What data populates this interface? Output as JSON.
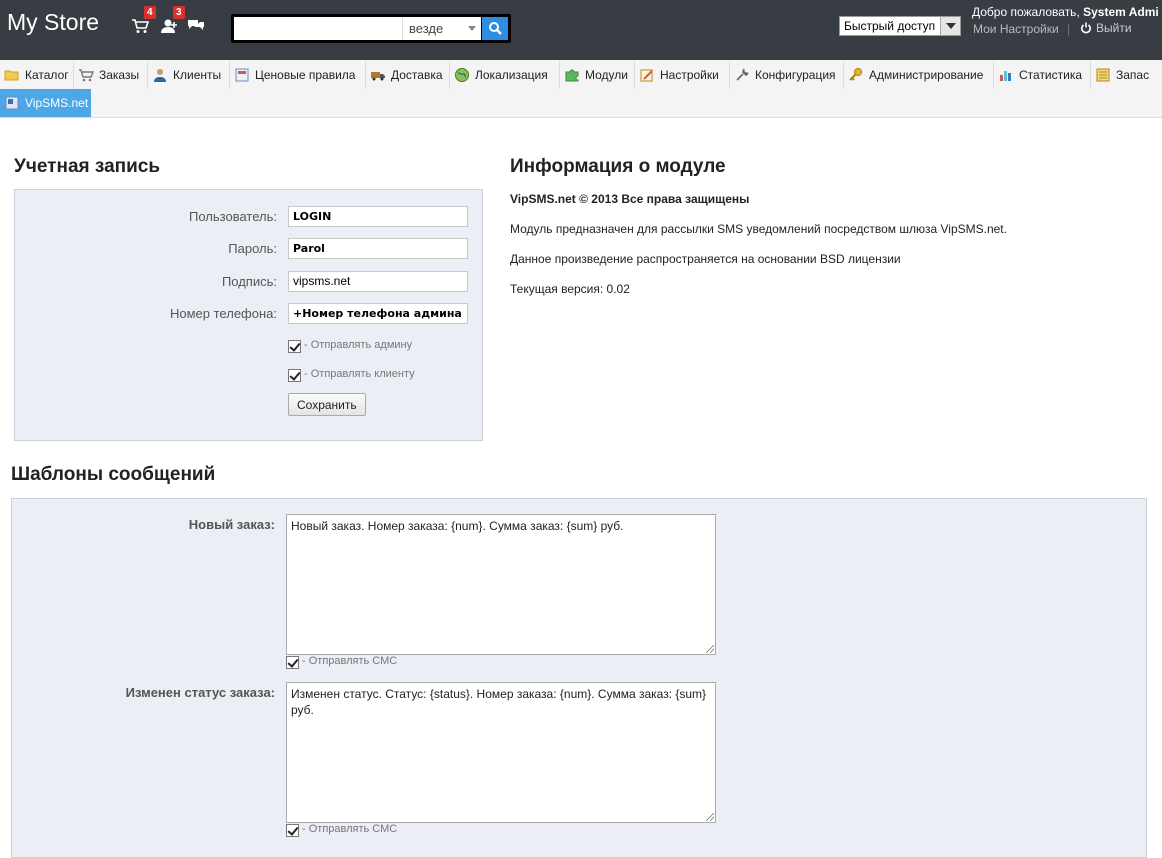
{
  "header": {
    "shop_name": "My Store",
    "orders_badge": "4",
    "customers_badge": "3",
    "search_placeholder": "",
    "search_scope": "везде",
    "quick_access": "Быстрый доступ",
    "welcome_prefix": "Добро пожаловать,",
    "user_name": "System Admi",
    "my_settings": "Мои Настройки",
    "separator": "|",
    "logout": "Выйти"
  },
  "nav": {
    "items": [
      {
        "label": "Каталог",
        "icon": "folder-icon"
      },
      {
        "label": "Заказы",
        "icon": "cart-icon"
      },
      {
        "label": "Клиенты",
        "icon": "user-icon"
      },
      {
        "label": "Ценовые правила",
        "icon": "price-rules-icon"
      },
      {
        "label": "Доставка",
        "icon": "truck-icon"
      },
      {
        "label": "Локализация",
        "icon": "globe-icon"
      },
      {
        "label": "Модули",
        "icon": "puzzle-icon"
      },
      {
        "label": "Настройки",
        "icon": "settings-icon"
      },
      {
        "label": "Конфигурация",
        "icon": "wrench-icon"
      },
      {
        "label": "Администрирование",
        "icon": "key-icon"
      },
      {
        "label": "Статистика",
        "icon": "bar-chart-icon"
      },
      {
        "label": "Запас",
        "icon": "stock-icon"
      }
    ],
    "active": {
      "label": "VipSMS.net",
      "icon": "vipsms-icon"
    }
  },
  "account": {
    "title": "Учетная запись",
    "user_label": "Пользователь:",
    "user_value": "LOGIN",
    "password_label": "Пароль:",
    "password_value": "Parol",
    "signature_label": "Подпись:",
    "signature_value": "vipsms.net",
    "phone_label": "Номер телефона:",
    "phone_value": "+Номер телефона админа",
    "send_admin": "- Отправлять админу",
    "send_client": "- Отправлять клиенту",
    "save": "Сохранить"
  },
  "module_info": {
    "title": "Информация о модуле",
    "copyright": "VipSMS.net © 2013 Все права защищены",
    "description": "Модуль предназначен для рассылки SMS уведомлений посредством шлюза VipSMS.net.",
    "license": "Данное произведение распространяется на основании BSD лицензии",
    "version": "Текущая версия: 0.02"
  },
  "templates": {
    "title": "Шаблоны сообщений",
    "new_order_label": "Новый заказ:",
    "new_order_text": "Новый заказ. Номер заказа: {num}. Сумма заказ: {sum} руб.",
    "status_label": "Изменен статус заказа:",
    "status_text": "Изменен статус. Статус: {status}. Номер заказа: {num}. Сумма заказ: {sum} руб.",
    "send_sms": "- Отправлять СМС"
  }
}
